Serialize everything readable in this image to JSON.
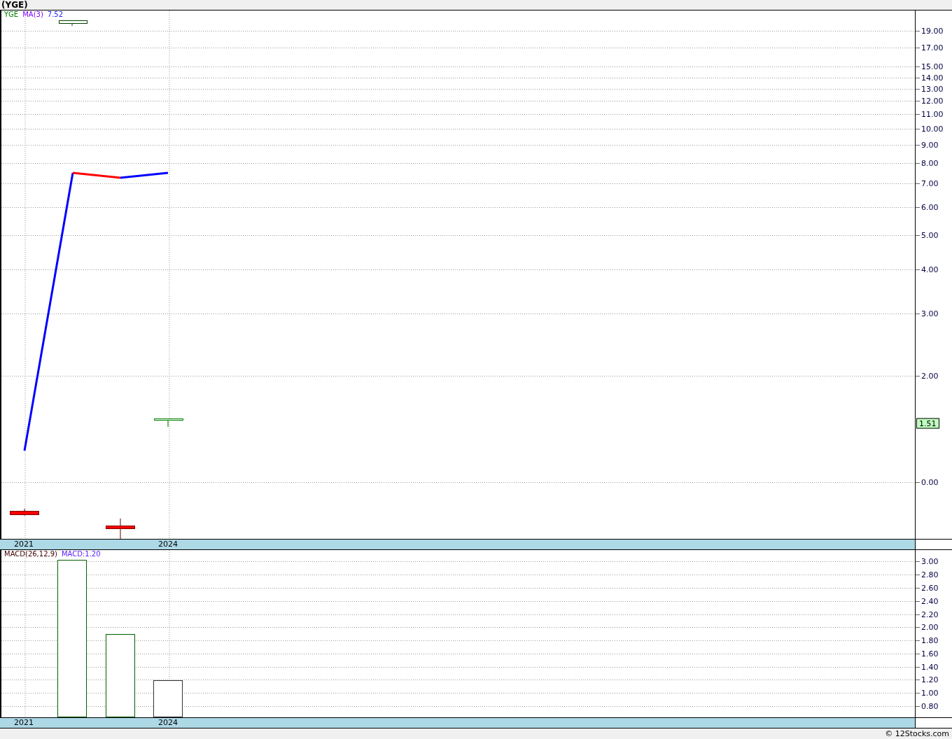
{
  "title": "(YGE)",
  "price_panel": {
    "legend": [
      {
        "kind": "symbol",
        "text": "YGE"
      },
      {
        "kind": "indicator",
        "text": "MA(3)"
      },
      {
        "kind": "value",
        "text": "7.52"
      }
    ],
    "y_ticks": [
      "19.00",
      "17.00",
      "15.00",
      "14.00",
      "13.00",
      "12.00",
      "11.00",
      "10.00",
      "9.00",
      "8.00",
      "7.00",
      "6.00",
      "5.00",
      "4.00",
      "3.00",
      "2.00",
      "0.00"
    ],
    "last_price": "1.51",
    "x_labels": [
      "2021",
      "2024"
    ]
  },
  "macd_panel": {
    "legend": [
      {
        "kind": "indicator",
        "text": "MACD(26,12,9)"
      },
      {
        "kind": "value",
        "text": "MACD:1.20"
      }
    ],
    "y_ticks": [
      "3.00",
      "2.80",
      "2.60",
      "2.40",
      "2.20",
      "2.00",
      "1.80",
      "1.60",
      "1.40",
      "1.20",
      "1.00",
      "0.80"
    ],
    "x_labels": [
      "2021",
      "2024"
    ]
  },
  "credit": "© 12Stocks.com"
}
